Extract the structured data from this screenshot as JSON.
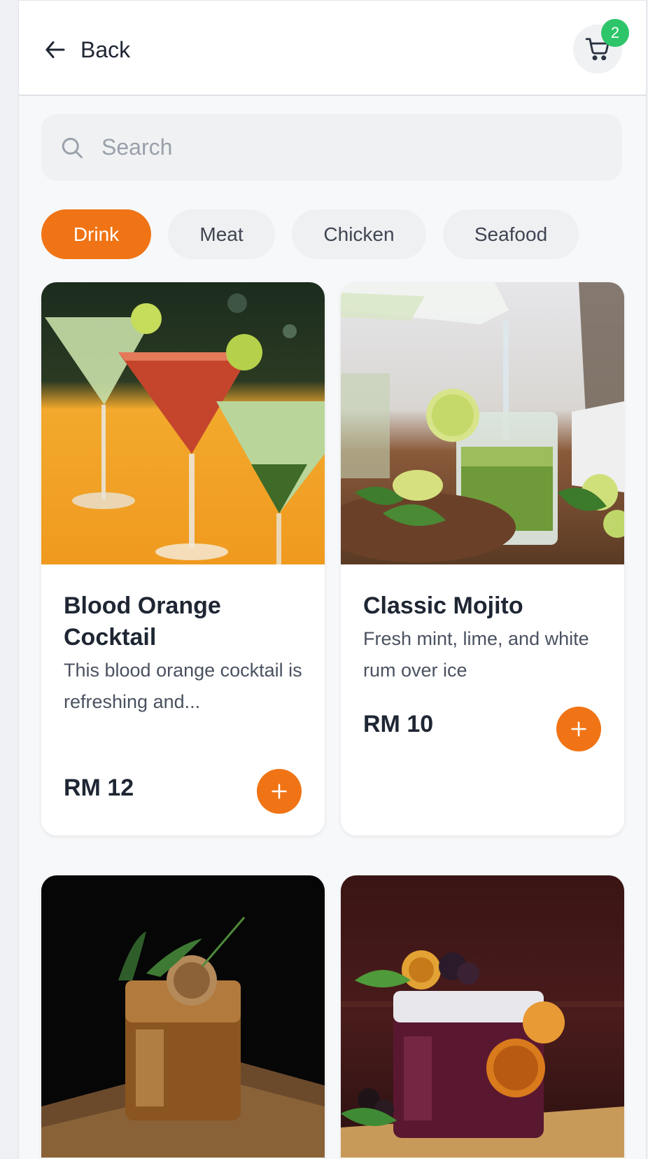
{
  "header": {
    "back_label": "Back",
    "cart_count": "2"
  },
  "search": {
    "placeholder": "Search",
    "value": ""
  },
  "categories": {
    "active": "Drink",
    "items": [
      "Drink",
      "Meat",
      "Chicken",
      "Seafood"
    ]
  },
  "products": [
    {
      "name": "Blood Orange Cocktail",
      "description": "This blood orange cocktail is refreshing and...",
      "price": "RM 12"
    },
    {
      "name": "Classic Mojito",
      "description": "Fresh mint, lime, and white rum over ice",
      "price": "RM 10"
    }
  ],
  "colors": {
    "accent": "#f07415",
    "badge": "#2ec56a",
    "text": "#1f2633"
  },
  "icons": {
    "back": "arrow-left-icon",
    "cart": "shopping-cart-icon",
    "search": "search-icon",
    "add": "plus-icon"
  }
}
